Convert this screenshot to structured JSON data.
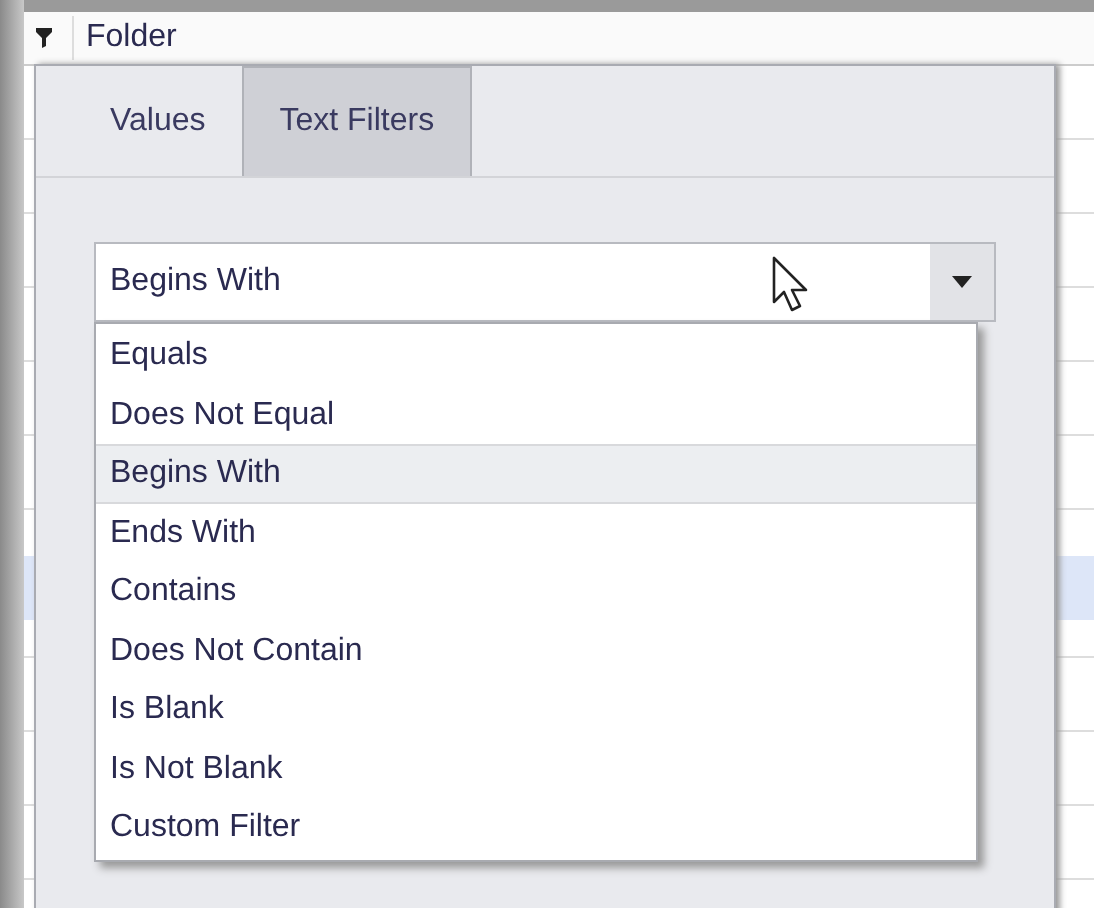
{
  "grid": {
    "header": "Folder"
  },
  "tabs": [
    {
      "label": "Values",
      "selected": false
    },
    {
      "label": "Text Filters",
      "selected": true
    }
  ],
  "combo": {
    "value": "Begins With"
  },
  "options": [
    {
      "label": "Equals",
      "selected": false
    },
    {
      "label": "Does Not Equal",
      "selected": false
    },
    {
      "label": "Begins With",
      "selected": true
    },
    {
      "label": "Ends With",
      "selected": false
    },
    {
      "label": "Contains",
      "selected": false
    },
    {
      "label": "Does Not Contain",
      "selected": false
    },
    {
      "label": "Is Blank",
      "selected": false
    },
    {
      "label": "Is Not Blank",
      "selected": false
    },
    {
      "label": "Custom Filter",
      "selected": false
    }
  ]
}
